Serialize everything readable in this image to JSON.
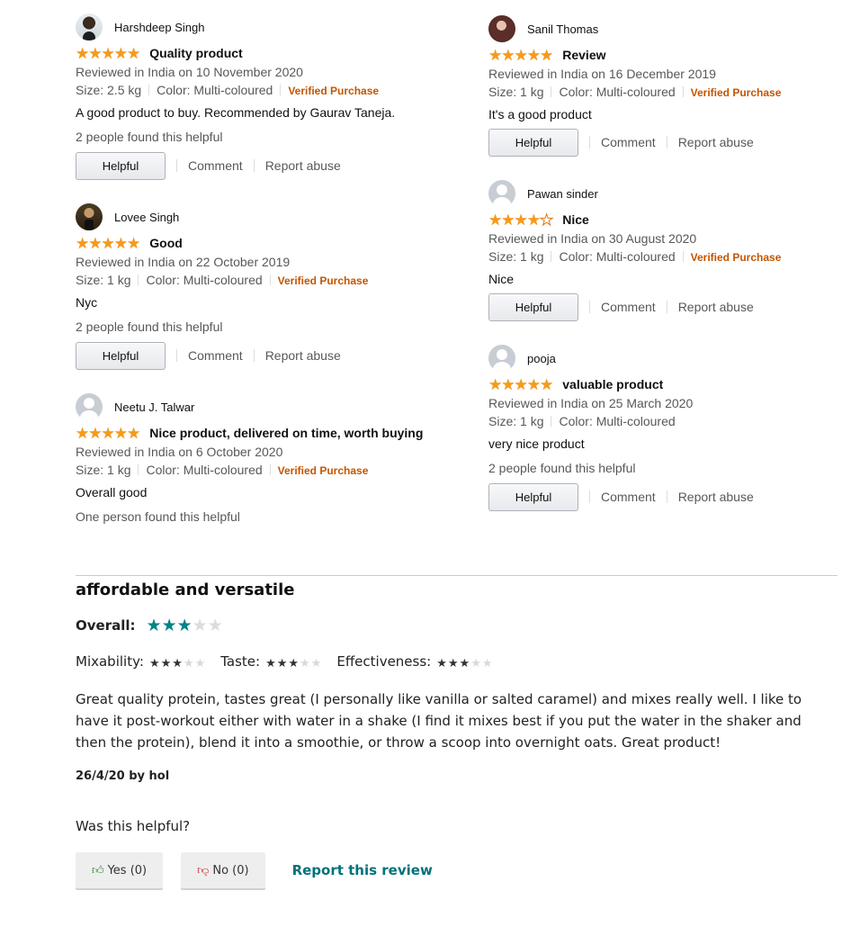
{
  "reviews_left": [
    {
      "name": "Harshdeep Singh",
      "rating": 5,
      "title": "Quality product",
      "date": "Reviewed in India on 10 November 2020",
      "size": "Size: 2.5 kg",
      "color": "Color: Multi-coloured",
      "verified": "Verified Purchase",
      "body": "A good product to buy. Recommended by Gaurav Taneja.",
      "helpful_count": "2 people found this helpful",
      "helpful_button": "Helpful",
      "comment": "Comment",
      "report": "Report abuse"
    },
    {
      "name": "Lovee Singh",
      "rating": 5,
      "title": "Good",
      "date": "Reviewed in India on 22 October 2019",
      "size": "Size: 1 kg",
      "color": "Color: Multi-coloured",
      "verified": "Verified Purchase",
      "body": "Nyc",
      "helpful_count": "2 people found this helpful",
      "helpful_button": "Helpful",
      "comment": "Comment",
      "report": "Report abuse"
    },
    {
      "name": "Neetu J. Talwar",
      "rating": 5,
      "title": "Nice product, delivered on time, worth buying",
      "date": "Reviewed in India on 6 October 2020",
      "size": "Size: 1 kg",
      "color": "Color: Multi-coloured",
      "verified": "Verified Purchase",
      "body": "Overall good",
      "helpful_count": "One person found this helpful"
    }
  ],
  "reviews_right": [
    {
      "name": "Sanil Thomas",
      "rating": 5,
      "title": "Review",
      "date": "Reviewed in India on 16 December 2019",
      "size": "Size: 1 kg",
      "color": "Color: Multi-coloured",
      "verified": "Verified Purchase",
      "body": "It's a good product",
      "helpful_button": "Helpful",
      "comment": "Comment",
      "report": "Report abuse"
    },
    {
      "name": "Pawan sinder",
      "rating": 4,
      "title": "Nice",
      "date": "Reviewed in India on 30 August 2020",
      "size": "Size: 1 kg",
      "color": "Color: Multi-coloured",
      "verified": "Verified Purchase",
      "body": "Nice",
      "helpful_button": "Helpful",
      "comment": "Comment",
      "report": "Report abuse"
    },
    {
      "name": "pooja",
      "rating": 5,
      "title": "valuable product",
      "date": "Reviewed in India on 25 March 2020",
      "size": "Size: 1 kg",
      "color": "Color: Multi-coloured",
      "body": "very nice product",
      "helpful_count": "2 people found this helpful",
      "helpful_button": "Helpful",
      "comment": "Comment",
      "report": "Report abuse"
    }
  ],
  "feature_review": {
    "title": "affordable and versatile",
    "overall_label": "Overall:",
    "overall_rating": 3,
    "attributes": [
      {
        "label": "Mixability:",
        "rating": 3
      },
      {
        "label": "Taste:",
        "rating": 3
      },
      {
        "label": "Effectiveness:",
        "rating": 3
      }
    ],
    "body": "Great quality protein, tastes great (I personally like vanilla or salted caramel) and mixes really well. I like to have it post-workout either with water in a shake (I find it mixes best if you put the water in the shaker and then the protein), blend it into a smoothie, or throw a scoop into overnight oats. Great product!",
    "meta": "26/4/20 by hol",
    "question": "Was this helpful?",
    "yes_label": "Yes (0)",
    "no_label": "No (0)",
    "report_label": "Report this review"
  },
  "colors": {
    "amazon_star": "#f79a1a",
    "verified": "#c45500",
    "teal_star": "#00838a",
    "teal_link": "#00727a"
  },
  "icons": {
    "thumb_up": "thumbs-up-icon",
    "thumb_down": "thumbs-down-icon",
    "star": "star-icon",
    "avatar": "avatar-icon"
  }
}
